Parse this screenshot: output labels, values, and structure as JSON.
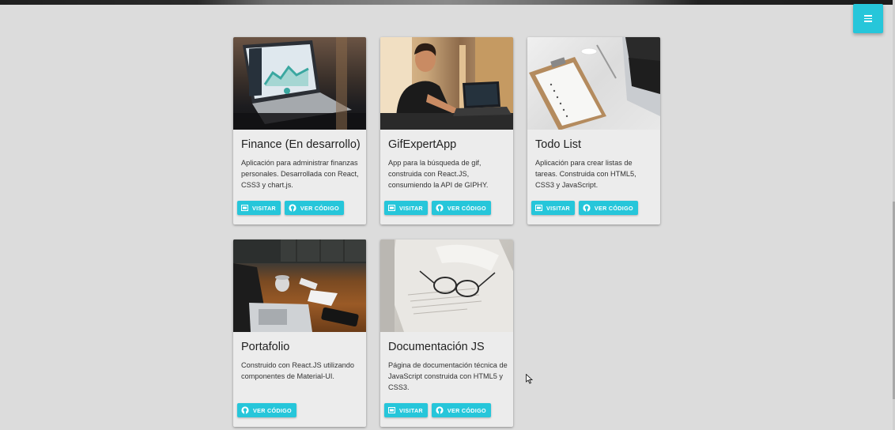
{
  "menu": {
    "icon": "menu-icon"
  },
  "projects": [
    {
      "title": "Finance (En desarrollo)",
      "description": "Aplicación para administrar finanzas personales. Desarrollada con React, CSS3 y chart.js.",
      "visit_label": "VISITAR",
      "code_label": "VER CÓDIGO"
    },
    {
      "title": "GifExpertApp",
      "description": "App para la búsqueda de gif, construida con React.JS, consumiendo la API de GIPHY.",
      "visit_label": "VISITAR",
      "code_label": "VER CÓDIGO"
    },
    {
      "title": "Todo List",
      "description": "Aplicación para crear listas de tareas. Construida con HTML5, CSS3 y JavaScript.",
      "visit_label": "VISITAR",
      "code_label": "VER CÓDIGO"
    },
    {
      "title": "Portafolio",
      "description": "Construido con React.JS utilizando componentes de Material-UI.",
      "code_label": "VER CÓDIGO"
    },
    {
      "title": "Documentación JS",
      "description": "Página de documentación técnica de JavaScript construida con HTML5 y CSS3.",
      "visit_label": "VISITAR",
      "code_label": "VER CÓDIGO"
    }
  ],
  "colors": {
    "accent": "#26c6da",
    "background": "#dcdcdc",
    "card": "#ececec"
  }
}
